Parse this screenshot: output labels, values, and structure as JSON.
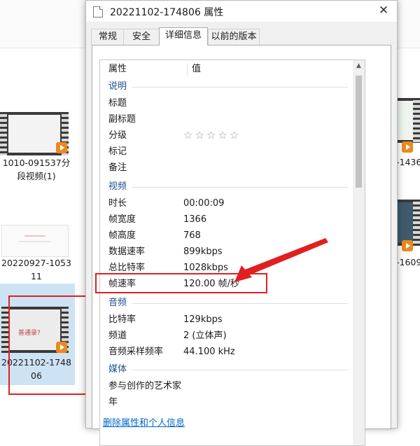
{
  "explorer": {
    "files": [
      {
        "label_line1": "1010-091537分",
        "label_line2": "段视频(1)"
      },
      {
        "label_line1": "20220927-1053",
        "label_line2": "11"
      },
      {
        "label_line1": "20221102-1748",
        "label_line2": "06",
        "thumb_text": "普通录?"
      },
      {
        "label": "-1436"
      },
      {
        "label": "-1609"
      }
    ]
  },
  "dialog": {
    "title": "20221102-174806 属性",
    "close_glyph": "✕",
    "tabs": [
      "常规",
      "安全",
      "详细信息",
      "以前的版本"
    ],
    "header": {
      "col1": "属性",
      "col2": "值"
    },
    "sections": {
      "description": "说明",
      "video": "视频",
      "audio": "音频",
      "media": "媒体"
    },
    "desc_rows": [
      {
        "key": "标题",
        "value": ""
      },
      {
        "key": "副标题",
        "value": ""
      },
      {
        "key": "分级",
        "value": "☆☆☆☆☆"
      },
      {
        "key": "标记",
        "value": ""
      },
      {
        "key": "备注",
        "value": ""
      }
    ],
    "video_rows": [
      {
        "key": "时长",
        "value": "00:00:09"
      },
      {
        "key": "帧宽度",
        "value": "1366"
      },
      {
        "key": "帧高度",
        "value": "768"
      },
      {
        "key": "数据速率",
        "value": "899kbps"
      },
      {
        "key": "总比特率",
        "value": "1028kbps"
      },
      {
        "key": "帧速率",
        "value": "120.00 帧/秒"
      }
    ],
    "audio_rows": [
      {
        "key": "比特率",
        "value": "129kbps"
      },
      {
        "key": "频道",
        "value": "2 (立体声)"
      },
      {
        "key": "音频采样频率",
        "value": "44.100 kHz"
      }
    ],
    "media_rows": [
      {
        "key": "参与创作的艺术家",
        "value": ""
      },
      {
        "key": "年",
        "value": ""
      }
    ],
    "remove_link": "删除属性和个人信息",
    "scroll_up_glyph": "▲"
  },
  "colors": {
    "annotation_red": "#e02020",
    "group_blue": "#1f4e8f",
    "link_blue": "#0066cc",
    "selection": "#cde3f4"
  }
}
